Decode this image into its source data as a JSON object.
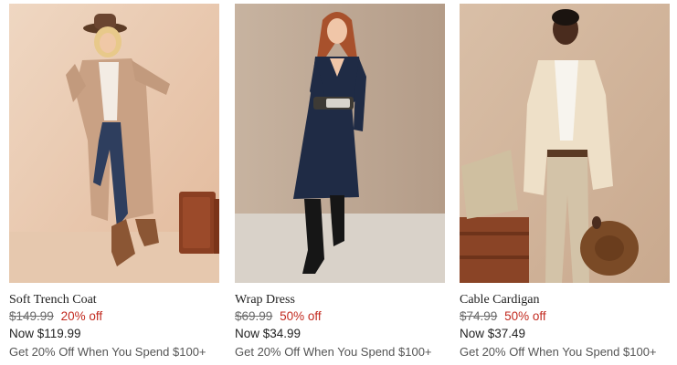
{
  "products": [
    {
      "name": "Soft Trench Coat",
      "was_price": "$149.99",
      "discount": "20% off",
      "now_price": "Now $119.99",
      "promo": "Get 20% Off When You Spend $100+",
      "image_icon": "product-photo-trench-coat"
    },
    {
      "name": "Wrap Dress",
      "was_price": "$69.99",
      "discount": "50% off",
      "now_price": "Now $34.99",
      "promo": "Get 20% Off When You Spend $100+",
      "image_icon": "product-photo-wrap-dress"
    },
    {
      "name": "Cable Cardigan",
      "was_price": "$74.99",
      "discount": "50% off",
      "now_price": "Now $37.49",
      "promo": "Get 20% Off When You Spend $100+",
      "image_icon": "product-photo-cable-cardigan"
    }
  ],
  "colors": {
    "discount": "#c22a1f",
    "strikethrough": "#6b6b6b",
    "text": "#222222",
    "promo": "#555555"
  }
}
